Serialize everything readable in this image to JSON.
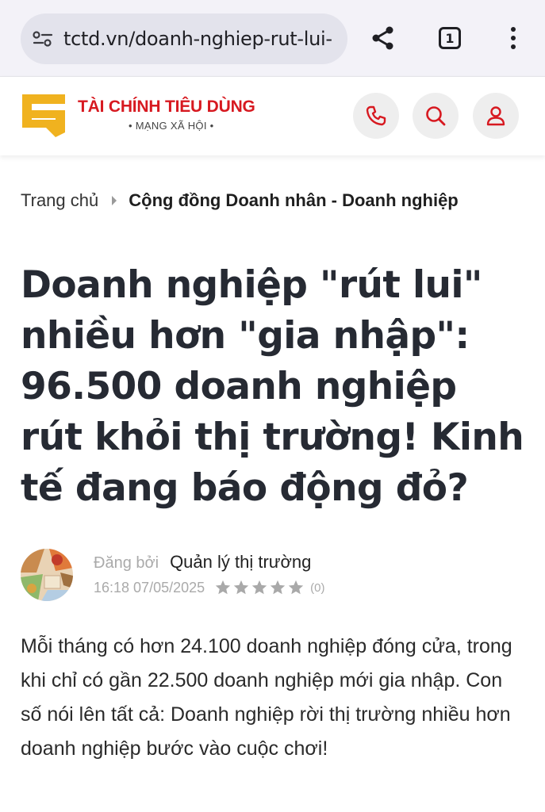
{
  "browser": {
    "url": "tctd.vn/doanh-nghiep-rut-lui-",
    "tab_count": "1",
    "icons": {
      "site_info": "site-info-icon",
      "share": "share-icon",
      "tabs": "tab-switcher-icon",
      "menu": "kebab-menu-icon"
    }
  },
  "site": {
    "logo_title": "TÀI CHÍNH TIÊU DÙNG",
    "logo_subtitle": "• MẠNG XÃ HỘI •",
    "brand_color": "#d71920",
    "logo_color": "#f0b21f",
    "icons": {
      "phone": "phone-icon",
      "search": "search-icon",
      "account": "user-icon"
    }
  },
  "breadcrumb": {
    "home": "Trang chủ",
    "current": "Cộng đồng Doanh nhân - Doanh nghiệp"
  },
  "article": {
    "title": "Doanh nghiệp \"rút lui\" nhiều hơn \"gia nhập\": 96.500 doanh nghiệp rút khỏi thị trường! Kinh tế đang báo động đỏ?",
    "posted_by_label": "Đăng bởi",
    "author": "Quản lý thị trường",
    "datetime": "16:18 07/05/2025",
    "rating_stars": 5,
    "rating_value": 0,
    "rating_count": "(0)",
    "summary": "Mỗi tháng có hơn 24.100 doanh nghiệp đóng cửa, trong khi chỉ có gần 22.500 doanh nghiệp mới gia nhập. Con số nói lên tất cả: Doanh nghiệp rời thị trường nhiều hơn doanh nghiệp bước vào cuộc chơi!"
  }
}
